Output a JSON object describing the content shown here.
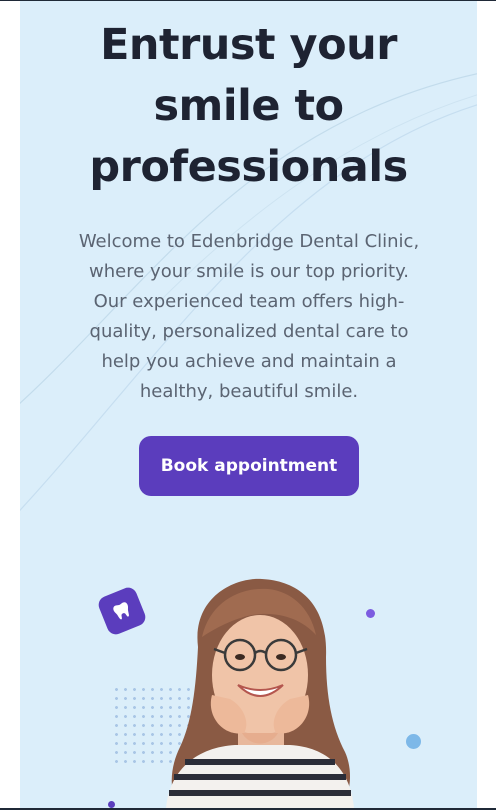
{
  "hero": {
    "title_lines": [
      "Entrust your",
      "smile to",
      "professionals"
    ],
    "description": "Welcome to Edenbridge Dental Clinic, where your smile is our top priority. Our experienced team offers high-quality, personalized dental care to help you achieve and maintain a healthy, beautiful smile.",
    "cta_label": "Book appointment"
  },
  "icons": {
    "badge": "tooth-icon"
  },
  "colors": {
    "background": "#dbeefa",
    "title": "#1e2332",
    "text": "#5b6472",
    "accent": "#5b3dbd",
    "accent_light": "#7c5ce0",
    "dot_blue": "#7db8e8"
  }
}
